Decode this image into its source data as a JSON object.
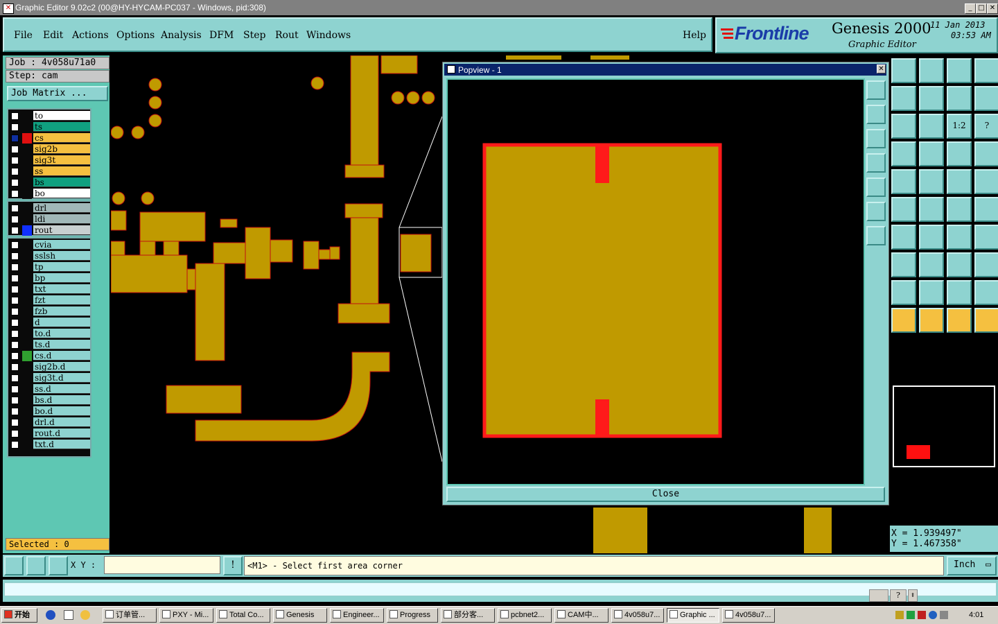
{
  "window": {
    "title": "Graphic Editor 9.02c2 (00@HY-HYCAM-PC037 - Windows, pid:308)"
  },
  "menu": [
    "File",
    "Edit",
    "Actions",
    "Options",
    "Analysis",
    "DFM",
    "Step",
    "Rout",
    "Windows"
  ],
  "help_label": "Help",
  "brand": {
    "logo": "Frontline",
    "product": "Genesis 2000",
    "subtitle": "Graphic Editor",
    "date": "11 Jan 2013",
    "time": "03:53 AM"
  },
  "job": {
    "job_label": "Job  : 4v058u71a0",
    "step_label": "Step: cam",
    "matrix_label": "Job Matrix ..."
  },
  "layers_group1": [
    {
      "name": "to",
      "bg": "#ffffff",
      "col": "#0a0a0a"
    },
    {
      "name": "ts",
      "bg": "#10a080",
      "col": "#0a0a0a"
    },
    {
      "name": "cs",
      "bg": "#f5c040",
      "col": "#e01010",
      "active": true
    },
    {
      "name": "sig2b",
      "bg": "#f5c040",
      "col": "#0a0a0a"
    },
    {
      "name": "sig3t",
      "bg": "#f5c040",
      "col": "#0a0a0a"
    },
    {
      "name": "ss",
      "bg": "#f5c040",
      "col": "#0a0a0a"
    },
    {
      "name": "bs",
      "bg": "#10a080",
      "col": "#0a0a0a"
    },
    {
      "name": "bo",
      "bg": "#ffffff",
      "col": "#0a0a0a"
    }
  ],
  "layers_group2": [
    {
      "name": "drl",
      "bg": "#a0b8b8",
      "col": "#0a0a0a"
    },
    {
      "name": "ldi",
      "bg": "#a0b8b8",
      "col": "#0a0a0a"
    },
    {
      "name": "rout",
      "bg": "#c8d0d0",
      "col": "#1030ff"
    }
  ],
  "layers_group3": [
    {
      "name": "cvia",
      "bg": "#8ed3d0",
      "col": "#0a0a0a"
    },
    {
      "name": "sslsh",
      "bg": "#8ed3d0",
      "col": "#0a0a0a"
    },
    {
      "name": "tp",
      "bg": "#8ed3d0",
      "col": "#0a0a0a"
    },
    {
      "name": "bp",
      "bg": "#8ed3d0",
      "col": "#0a0a0a"
    },
    {
      "name": "txt",
      "bg": "#8ed3d0",
      "col": "#0a0a0a"
    },
    {
      "name": "fzt",
      "bg": "#8ed3d0",
      "col": "#0a0a0a"
    },
    {
      "name": "fzb",
      "bg": "#8ed3d0",
      "col": "#0a0a0a"
    },
    {
      "name": "d",
      "bg": "#8ed3d0",
      "col": "#0a0a0a"
    },
    {
      "name": "to.d",
      "bg": "#8ed3d0",
      "col": "#0a0a0a"
    },
    {
      "name": "ts.d",
      "bg": "#8ed3d0",
      "col": "#0a0a0a"
    },
    {
      "name": "cs.d",
      "bg": "#8ed3d0",
      "col": "#30a030"
    },
    {
      "name": "sig2b.d",
      "bg": "#8ed3d0",
      "col": "#0a0a0a"
    },
    {
      "name": "sig3t.d",
      "bg": "#8ed3d0",
      "col": "#0a0a0a"
    },
    {
      "name": "ss.d",
      "bg": "#8ed3d0",
      "col": "#0a0a0a"
    },
    {
      "name": "bs.d",
      "bg": "#8ed3d0",
      "col": "#0a0a0a"
    },
    {
      "name": "bo.d",
      "bg": "#8ed3d0",
      "col": "#0a0a0a"
    },
    {
      "name": "drl.d",
      "bg": "#8ed3d0",
      "col": "#0a0a0a"
    },
    {
      "name": "rout.d",
      "bg": "#8ed3d0",
      "col": "#0a0a0a"
    },
    {
      "name": "txt.d",
      "bg": "#8ed3d0",
      "col": "#0a0a0a"
    }
  ],
  "selected_label": "Selected : 0",
  "popview": {
    "title": "Popview - 1",
    "close_label": "Close"
  },
  "coords": {
    "x": "X  =  1.939497\"",
    "y": "Y  =  1.467358\""
  },
  "toolbar_labels": {
    "one_to_two": "1:2",
    "help": "?"
  },
  "cmd": {
    "xy_label": "X Y :",
    "prompt": "<M1> - Select first area corner",
    "unit": "Inch"
  },
  "taskbar": {
    "start": "开始",
    "clock": "4:01",
    "tasks": [
      "订单管...",
      "PXY - Mi...",
      "Total Co...",
      "Genesis",
      "Engineer...",
      "Progress",
      "部分客...",
      "pcbnet2...",
      "CAM中...",
      "4v058u7...",
      "Graphic ...",
      "4v058u7..."
    ]
  },
  "colors": {
    "copper": "#c09a00",
    "outline": "#ff1a1a",
    "panel": "#8ed3d0",
    "panel_dark": "#5ec7b3"
  }
}
